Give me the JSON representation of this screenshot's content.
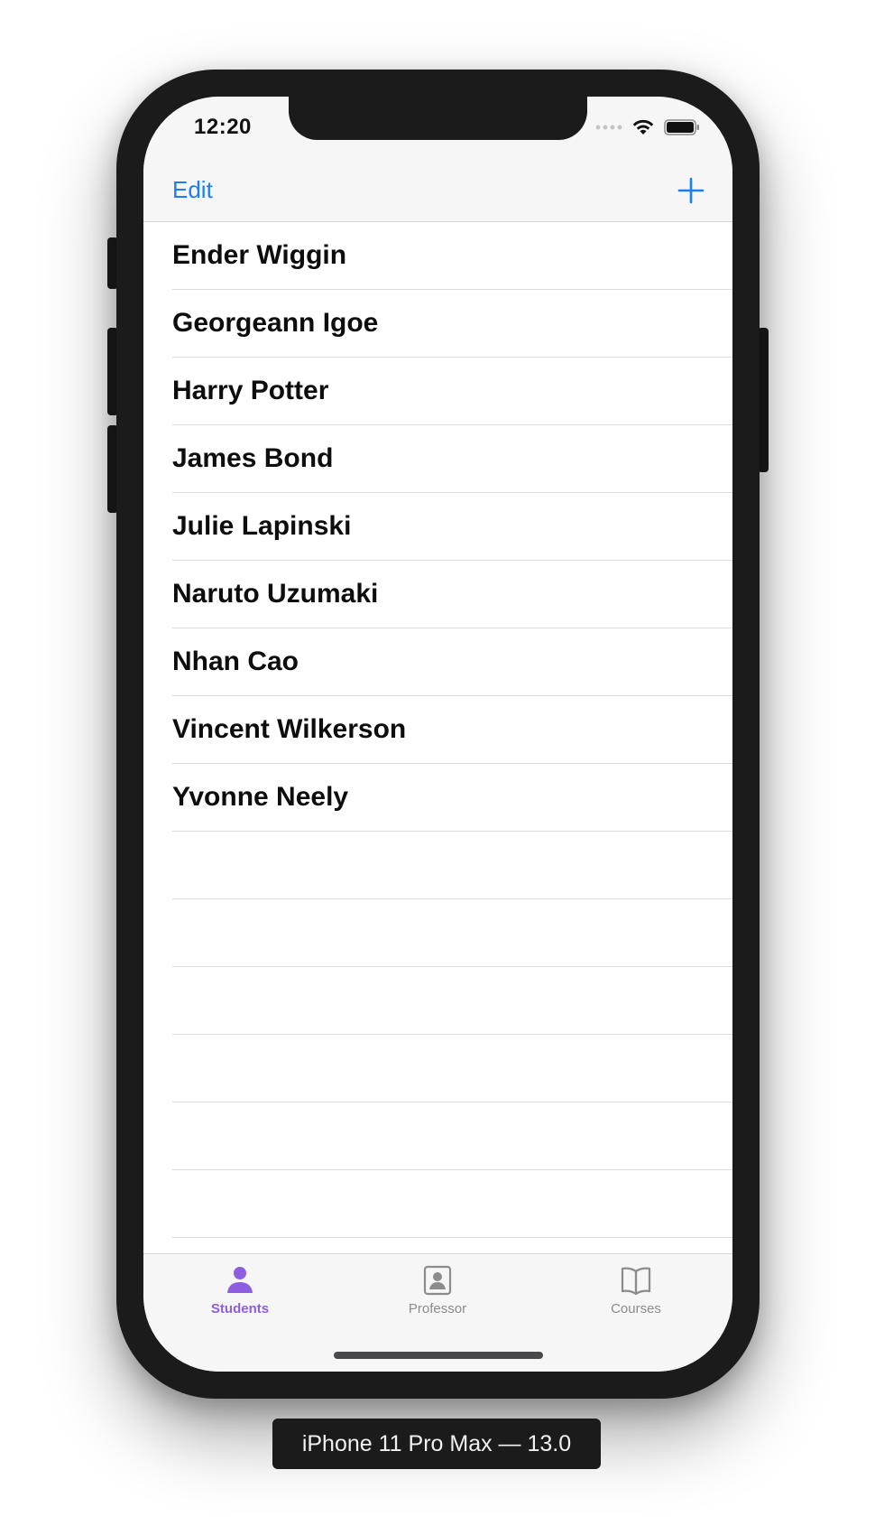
{
  "status_bar": {
    "time": "12:20",
    "icons": [
      "signal-dots-icon",
      "wifi-icon",
      "battery-icon"
    ]
  },
  "nav_bar": {
    "edit_label": "Edit",
    "add_icon": "plus-icon",
    "accent_color": "#1a7ff2"
  },
  "students": [
    "Ender Wiggin",
    "Georgeann Igoe",
    "Harry Potter",
    "James Bond",
    "Julie Lapinski",
    "Naruto Uzumaki",
    "Nhan Cao",
    "Vincent Wilkerson",
    "Yvonne Neely"
  ],
  "tab_bar": {
    "active_color": "#8e5ee0",
    "inactive_color": "#8c8c8e",
    "tabs": [
      {
        "label": "Students",
        "icon": "person-icon",
        "active": true
      },
      {
        "label": "Professor",
        "icon": "contact-card-icon",
        "active": false
      },
      {
        "label": "Courses",
        "icon": "book-icon",
        "active": false
      }
    ]
  },
  "device_label": "iPhone 11 Pro Max — 13.0"
}
